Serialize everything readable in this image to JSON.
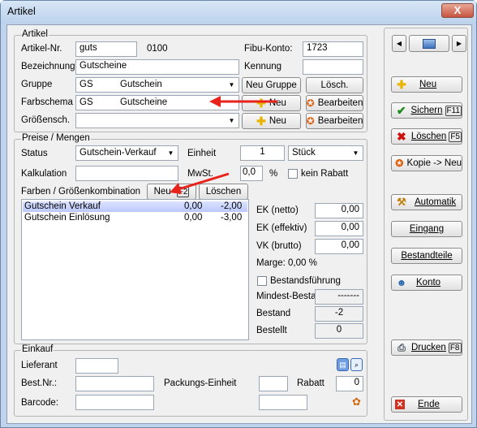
{
  "window": {
    "title": "Artikel",
    "close": "X"
  },
  "artikel": {
    "group_label": "Artikel",
    "nr_label": "Artikel-Nr.",
    "nr_value": "guts",
    "nr_suffix": "0100",
    "fibu_label": "Fibu-Konto:",
    "fibu_value": "1723",
    "bez_label": "Bezeichnung",
    "bez_value": "Gutscheine",
    "kennung_label": "Kennung",
    "kennung_value": "",
    "gruppe_label": "Gruppe",
    "gruppe_code": "GS",
    "gruppe_name": "Gutschein",
    "neu_gruppe": "Neu Gruppe",
    "loesch": "Lösch.",
    "farb_label": "Farbschema",
    "farb_code": "GS",
    "farb_name": "Gutscheine",
    "neu": "Neu",
    "bearbeiten": "Bearbeiten",
    "groessen_label": "Größensch.",
    "groessen_value": ""
  },
  "preise": {
    "group_label": "Preise / Mengen",
    "status_label": "Status",
    "status_value": "Gutschein-Verkauf",
    "einheit_label": "Einheit",
    "einheit_qty": "1",
    "einheit_unit": "Stück",
    "kalk_label": "Kalkulation",
    "kalk_value": "",
    "mwst_label": "MwSt.",
    "mwst_value": "0,0",
    "percent": "%",
    "kein_rabatt": "kein Rabatt",
    "farben_label": "Farben / Größenkombination",
    "neu_btn": "Neu",
    "neu_key": "F2",
    "loeschen_btn": "Löschen",
    "rows": [
      {
        "name": "Gutschein Verkauf",
        "a": "0,00",
        "b": "-2,00"
      },
      {
        "name": "Gutschein Einlösung",
        "a": "0,00",
        "b": "-3,00"
      }
    ],
    "ek_netto_label": "EK (netto)",
    "ek_netto": "0,00",
    "ek_eff_label": "EK (effektiv)",
    "ek_eff": "0,00",
    "vk_label": "VK (brutto)",
    "vk": "0,00",
    "marge": "Marge: 0,00 %",
    "bestandsfuehrung": "Bestandsführung",
    "mindest_label": "Mindest-Bestand",
    "mindest_value": "-------",
    "bestand_label": "Bestand",
    "bestand_value": "-2",
    "bestellt_label": "Bestellt",
    "bestellt_value": "0"
  },
  "einkauf": {
    "group_label": "Einkauf",
    "lieferant_label": "Lieferant",
    "lieferant_value": "",
    "bestnr_label": "Best.Nr.:",
    "bestnr_value": "",
    "packung_label": "Packungs-Einheit",
    "packung_value": "",
    "rabatt_label": "Rabatt",
    "rabatt_value": "0",
    "barcode_label": "Barcode:",
    "barcode_value": "",
    "barcode2_value": ""
  },
  "sidebar": {
    "nav_prev": "◀",
    "nav_next": "▶",
    "neu": "Neu",
    "sichern": "Sichern",
    "sichern_key": "F11",
    "loeschen": "Löschen",
    "loeschen_key": "F5",
    "kopie": "Kopie -> Neu",
    "automatik": "Automatik",
    "eingang": "Eingang",
    "bestandteile": "Bestandteile",
    "konto": "Konto",
    "drucken": "Drucken",
    "drucken_key": "F8",
    "ende": "Ende"
  },
  "colors": {
    "accent_red": "#e8231c",
    "selection": "#c6d0ff"
  }
}
